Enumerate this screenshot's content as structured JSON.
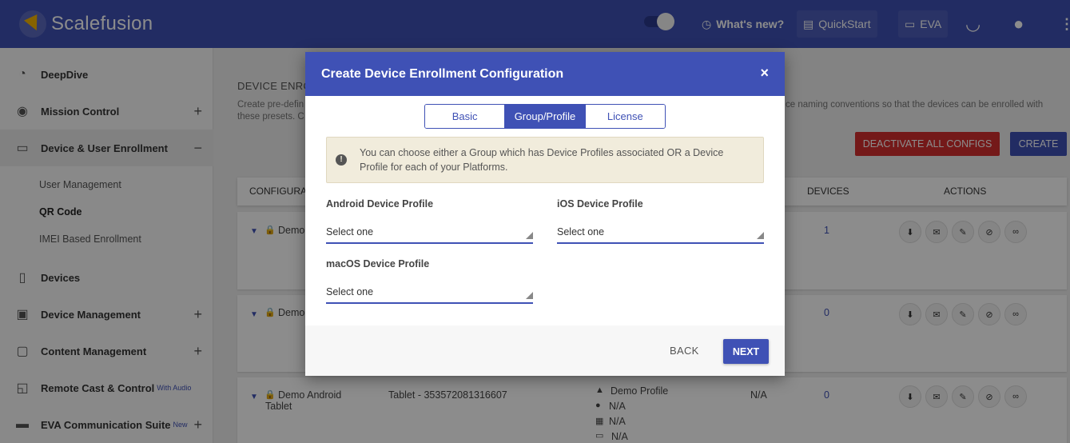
{
  "topbar": {
    "brand": "Scalefusion",
    "whats_new": "What's new?",
    "quickstart": "QuickStart",
    "eva": "EVA"
  },
  "sidebar": {
    "items": [
      {
        "label": "DeepDive",
        "icon": "speedometer-icon"
      },
      {
        "label": "Mission Control",
        "icon": "mission-control-icon",
        "expander": "+"
      },
      {
        "label": "Device & User Enrollment",
        "icon": "devices-icon",
        "expander": "−"
      },
      {
        "label": "Devices",
        "icon": "smartphone-icon"
      },
      {
        "label": "Device Management",
        "icon": "briefcase-icon",
        "expander": "+"
      },
      {
        "label": "Content Management",
        "icon": "folder-icon",
        "expander": "+"
      },
      {
        "label": "Remote Cast & Control",
        "icon": "cast-icon",
        "sup": "With Audio"
      },
      {
        "label": "EVA Communication Suite",
        "icon": "chat-icon",
        "sup": "New",
        "expander": "+"
      }
    ],
    "subitems": [
      "User Management",
      "QR Code",
      "IMEI Based Enrollment"
    ]
  },
  "main": {
    "title": "DEVICE ENRO",
    "desc_left": "Create pre-defin",
    "desc_left2": "these presets. C",
    "desc_right": "ce naming conventions so that the devices can be enrolled with",
    "deactivate_label": "DEACTIVATE ALL CONFIGS",
    "create_label": "CREATE",
    "headers": {
      "config": "CONFIGURAT",
      "devices": "DEVICES",
      "actions": "ACTIONS"
    },
    "rows": [
      {
        "name": "Demo",
        "name2": "",
        "imei": "",
        "profile": "",
        "na": "",
        "devices": "1"
      },
      {
        "name": "Demo",
        "name2": "",
        "imei": "",
        "profile": "",
        "na": "",
        "devices": "0"
      },
      {
        "name": "Demo Android",
        "name2": "Tablet",
        "imei": "Tablet - 353572081316607",
        "profile": "Demo Profile",
        "na": "N/A",
        "devices": "0",
        "platform_values": [
          "N/A",
          "N/A",
          "N/A"
        ]
      }
    ]
  },
  "modal": {
    "title": "Create Device Enrollment Configuration",
    "close": "×",
    "tabs": [
      "Basic",
      "Group/Profile",
      "License"
    ],
    "active_tab": "Group/Profile",
    "notice_icon": "!",
    "notice": "You can choose either a Group which has Device Profiles associated OR a Device Profile for each of your Platforms.",
    "android_label": "Android Device Profile",
    "android_value": "Select one",
    "ios_label": "iOS Device Profile",
    "ios_value": "Select one",
    "macos_label": "macOS Device Profile",
    "macos_value": "Select one",
    "back": "BACK",
    "next": "NEXT"
  },
  "colors": {
    "primary": "#3f51b5",
    "danger": "#d32f2f",
    "notice_bg": "#f1ecdc"
  }
}
